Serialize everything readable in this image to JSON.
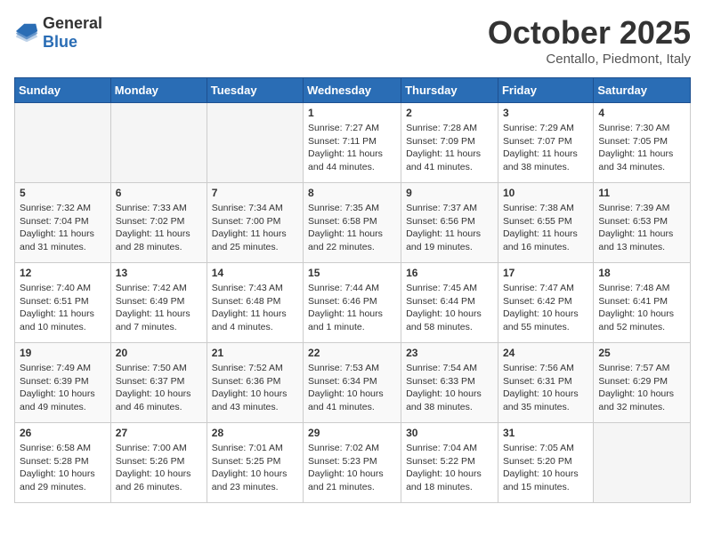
{
  "header": {
    "logo_general": "General",
    "logo_blue": "Blue",
    "month_title": "October 2025",
    "location": "Centallo, Piedmont, Italy"
  },
  "days_of_week": [
    "Sunday",
    "Monday",
    "Tuesday",
    "Wednesday",
    "Thursday",
    "Friday",
    "Saturday"
  ],
  "weeks": [
    [
      {
        "day": "",
        "sunrise": "",
        "sunset": "",
        "daylight": ""
      },
      {
        "day": "",
        "sunrise": "",
        "sunset": "",
        "daylight": ""
      },
      {
        "day": "",
        "sunrise": "",
        "sunset": "",
        "daylight": ""
      },
      {
        "day": "1",
        "sunrise": "Sunrise: 7:27 AM",
        "sunset": "Sunset: 7:11 PM",
        "daylight": "Daylight: 11 hours and 44 minutes."
      },
      {
        "day": "2",
        "sunrise": "Sunrise: 7:28 AM",
        "sunset": "Sunset: 7:09 PM",
        "daylight": "Daylight: 11 hours and 41 minutes."
      },
      {
        "day": "3",
        "sunrise": "Sunrise: 7:29 AM",
        "sunset": "Sunset: 7:07 PM",
        "daylight": "Daylight: 11 hours and 38 minutes."
      },
      {
        "day": "4",
        "sunrise": "Sunrise: 7:30 AM",
        "sunset": "Sunset: 7:05 PM",
        "daylight": "Daylight: 11 hours and 34 minutes."
      }
    ],
    [
      {
        "day": "5",
        "sunrise": "Sunrise: 7:32 AM",
        "sunset": "Sunset: 7:04 PM",
        "daylight": "Daylight: 11 hours and 31 minutes."
      },
      {
        "day": "6",
        "sunrise": "Sunrise: 7:33 AM",
        "sunset": "Sunset: 7:02 PM",
        "daylight": "Daylight: 11 hours and 28 minutes."
      },
      {
        "day": "7",
        "sunrise": "Sunrise: 7:34 AM",
        "sunset": "Sunset: 7:00 PM",
        "daylight": "Daylight: 11 hours and 25 minutes."
      },
      {
        "day": "8",
        "sunrise": "Sunrise: 7:35 AM",
        "sunset": "Sunset: 6:58 PM",
        "daylight": "Daylight: 11 hours and 22 minutes."
      },
      {
        "day": "9",
        "sunrise": "Sunrise: 7:37 AM",
        "sunset": "Sunset: 6:56 PM",
        "daylight": "Daylight: 11 hours and 19 minutes."
      },
      {
        "day": "10",
        "sunrise": "Sunrise: 7:38 AM",
        "sunset": "Sunset: 6:55 PM",
        "daylight": "Daylight: 11 hours and 16 minutes."
      },
      {
        "day": "11",
        "sunrise": "Sunrise: 7:39 AM",
        "sunset": "Sunset: 6:53 PM",
        "daylight": "Daylight: 11 hours and 13 minutes."
      }
    ],
    [
      {
        "day": "12",
        "sunrise": "Sunrise: 7:40 AM",
        "sunset": "Sunset: 6:51 PM",
        "daylight": "Daylight: 11 hours and 10 minutes."
      },
      {
        "day": "13",
        "sunrise": "Sunrise: 7:42 AM",
        "sunset": "Sunset: 6:49 PM",
        "daylight": "Daylight: 11 hours and 7 minutes."
      },
      {
        "day": "14",
        "sunrise": "Sunrise: 7:43 AM",
        "sunset": "Sunset: 6:48 PM",
        "daylight": "Daylight: 11 hours and 4 minutes."
      },
      {
        "day": "15",
        "sunrise": "Sunrise: 7:44 AM",
        "sunset": "Sunset: 6:46 PM",
        "daylight": "Daylight: 11 hours and 1 minute."
      },
      {
        "day": "16",
        "sunrise": "Sunrise: 7:45 AM",
        "sunset": "Sunset: 6:44 PM",
        "daylight": "Daylight: 10 hours and 58 minutes."
      },
      {
        "day": "17",
        "sunrise": "Sunrise: 7:47 AM",
        "sunset": "Sunset: 6:42 PM",
        "daylight": "Daylight: 10 hours and 55 minutes."
      },
      {
        "day": "18",
        "sunrise": "Sunrise: 7:48 AM",
        "sunset": "Sunset: 6:41 PM",
        "daylight": "Daylight: 10 hours and 52 minutes."
      }
    ],
    [
      {
        "day": "19",
        "sunrise": "Sunrise: 7:49 AM",
        "sunset": "Sunset: 6:39 PM",
        "daylight": "Daylight: 10 hours and 49 minutes."
      },
      {
        "day": "20",
        "sunrise": "Sunrise: 7:50 AM",
        "sunset": "Sunset: 6:37 PM",
        "daylight": "Daylight: 10 hours and 46 minutes."
      },
      {
        "day": "21",
        "sunrise": "Sunrise: 7:52 AM",
        "sunset": "Sunset: 6:36 PM",
        "daylight": "Daylight: 10 hours and 43 minutes."
      },
      {
        "day": "22",
        "sunrise": "Sunrise: 7:53 AM",
        "sunset": "Sunset: 6:34 PM",
        "daylight": "Daylight: 10 hours and 41 minutes."
      },
      {
        "day": "23",
        "sunrise": "Sunrise: 7:54 AM",
        "sunset": "Sunset: 6:33 PM",
        "daylight": "Daylight: 10 hours and 38 minutes."
      },
      {
        "day": "24",
        "sunrise": "Sunrise: 7:56 AM",
        "sunset": "Sunset: 6:31 PM",
        "daylight": "Daylight: 10 hours and 35 minutes."
      },
      {
        "day": "25",
        "sunrise": "Sunrise: 7:57 AM",
        "sunset": "Sunset: 6:29 PM",
        "daylight": "Daylight: 10 hours and 32 minutes."
      }
    ],
    [
      {
        "day": "26",
        "sunrise": "Sunrise: 6:58 AM",
        "sunset": "Sunset: 5:28 PM",
        "daylight": "Daylight: 10 hours and 29 minutes."
      },
      {
        "day": "27",
        "sunrise": "Sunrise: 7:00 AM",
        "sunset": "Sunset: 5:26 PM",
        "daylight": "Daylight: 10 hours and 26 minutes."
      },
      {
        "day": "28",
        "sunrise": "Sunrise: 7:01 AM",
        "sunset": "Sunset: 5:25 PM",
        "daylight": "Daylight: 10 hours and 23 minutes."
      },
      {
        "day": "29",
        "sunrise": "Sunrise: 7:02 AM",
        "sunset": "Sunset: 5:23 PM",
        "daylight": "Daylight: 10 hours and 21 minutes."
      },
      {
        "day": "30",
        "sunrise": "Sunrise: 7:04 AM",
        "sunset": "Sunset: 5:22 PM",
        "daylight": "Daylight: 10 hours and 18 minutes."
      },
      {
        "day": "31",
        "sunrise": "Sunrise: 7:05 AM",
        "sunset": "Sunset: 5:20 PM",
        "daylight": "Daylight: 10 hours and 15 minutes."
      },
      {
        "day": "",
        "sunrise": "",
        "sunset": "",
        "daylight": ""
      }
    ]
  ]
}
